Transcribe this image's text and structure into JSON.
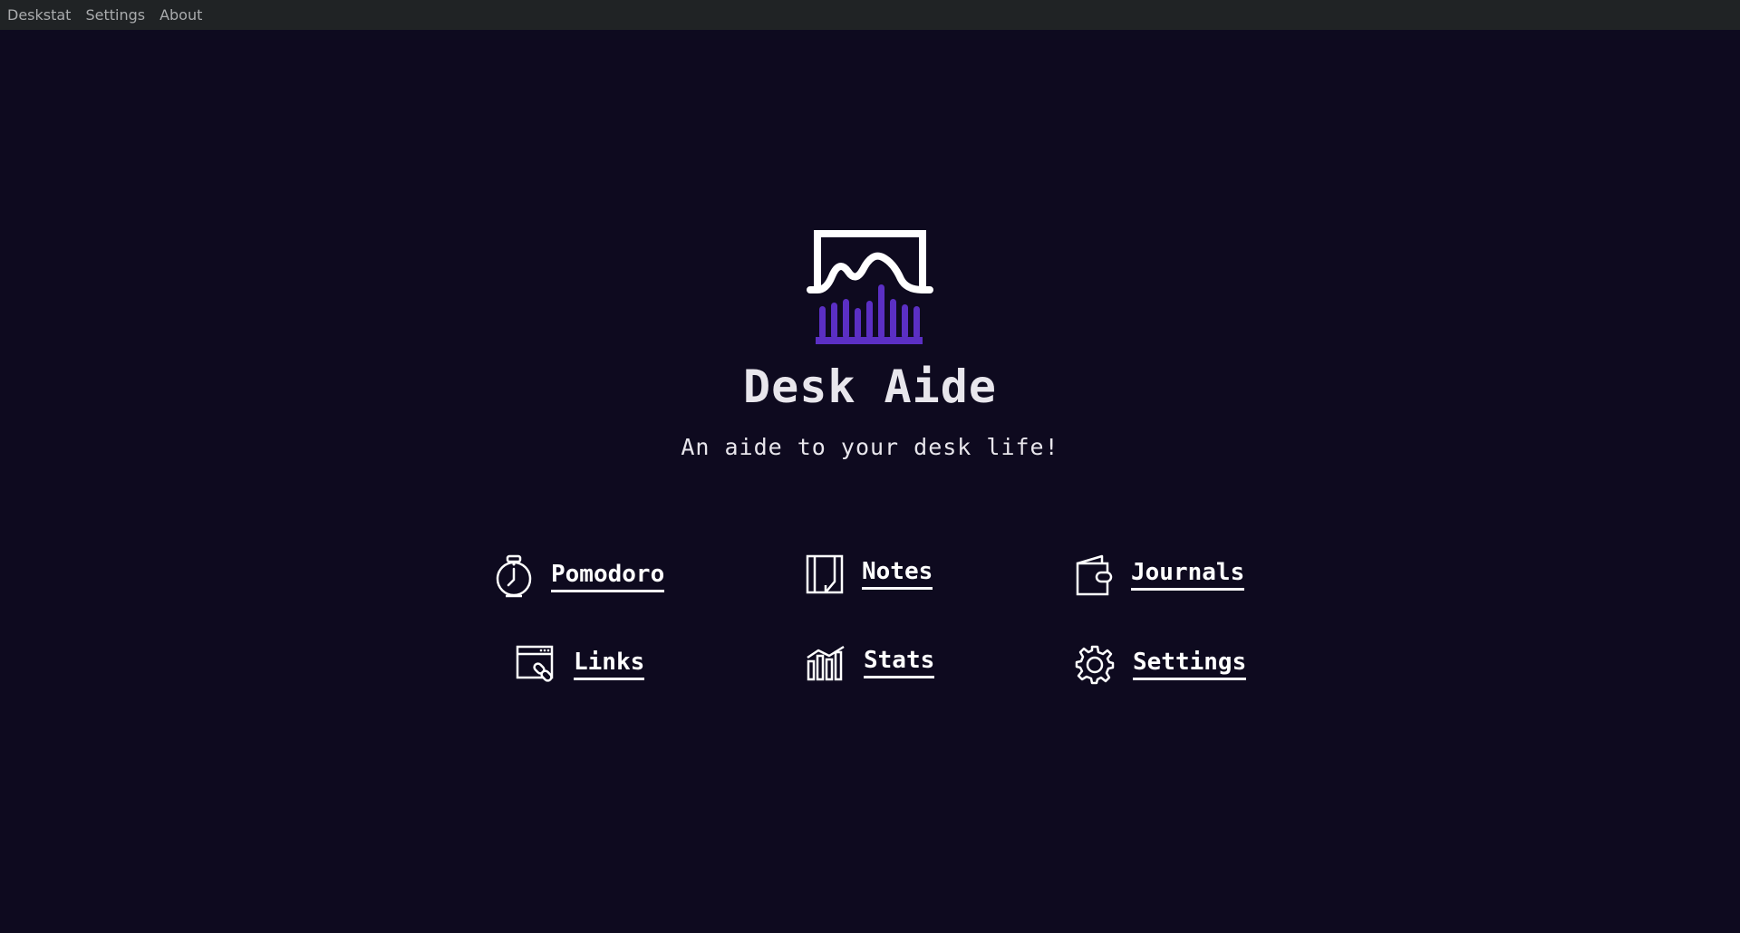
{
  "menubar": {
    "items": [
      {
        "label": "Deskstat"
      },
      {
        "label": "Settings"
      },
      {
        "label": "About"
      }
    ]
  },
  "app": {
    "title": "Desk Aide",
    "subtitle": "An aide to your desk life!",
    "logo_icon": "desk-chart-logo-icon",
    "colors": {
      "background": "#0e0a1f",
      "accent": "#5b2fc4",
      "text": "#ffffff",
      "menubar": "#202325"
    }
  },
  "nav": {
    "pomodoro": {
      "label": "Pomodoro",
      "icon": "stopwatch-icon"
    },
    "notes": {
      "label": "Notes",
      "icon": "notebook-icon"
    },
    "journals": {
      "label": "Journals",
      "icon": "wallet-icon"
    },
    "links": {
      "label": "Links",
      "icon": "browser-link-icon"
    },
    "stats": {
      "label": "Stats",
      "icon": "bar-chart-icon"
    },
    "settings": {
      "label": "Settings",
      "icon": "gear-icon"
    }
  }
}
